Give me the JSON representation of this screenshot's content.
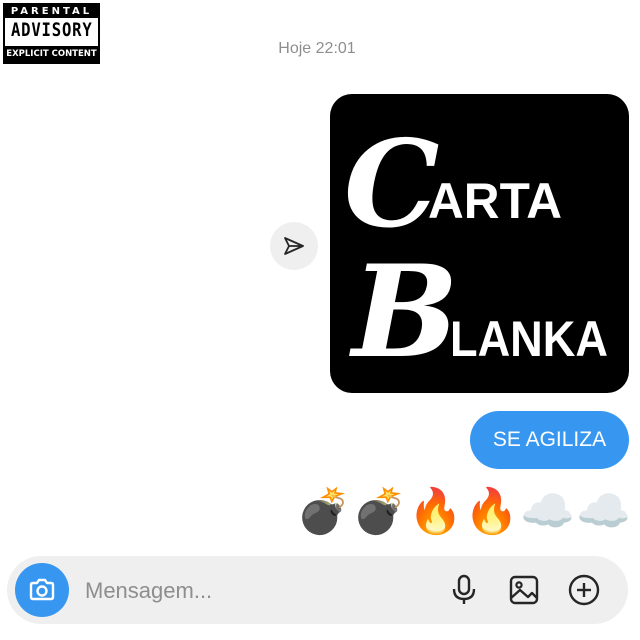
{
  "advisory": {
    "top": "PARENTAL",
    "middle": "ADVISORY",
    "bottom": "EXPLICIT CONTENT"
  },
  "chat": {
    "timestamp": "Hoje 22:01",
    "shared_image": {
      "line1_initial": "C",
      "line1_rest": "ARTA",
      "line2_initial": "B",
      "line2_rest": "LANKA"
    },
    "sent_message": "SE AGILIZA",
    "emojis": [
      "💣",
      "💣",
      "🔥",
      "🔥",
      "☁️",
      "☁️"
    ]
  },
  "composer": {
    "placeholder": "Mensagem...",
    "icons": [
      "camera-icon",
      "microphone-icon",
      "gallery-icon",
      "add-icon"
    ]
  },
  "colors": {
    "accent": "#3797f0",
    "background": "#ffffff",
    "composer_bg": "#efefef",
    "muted_text": "#8e8e8e"
  }
}
